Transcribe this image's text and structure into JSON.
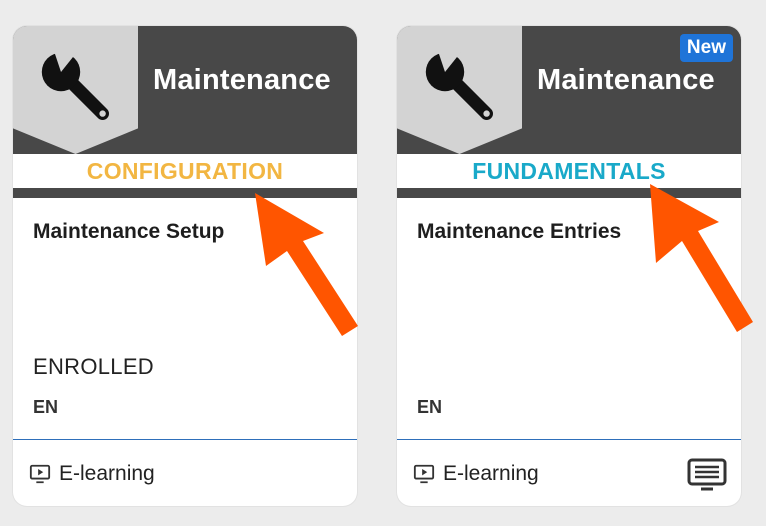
{
  "cards": [
    {
      "category": "Maintenance",
      "label": "CONFIGURATION",
      "label_color": "#f2b642",
      "badge": "",
      "title": "Maintenance Setup",
      "status": "ENROLLED",
      "language": "EN",
      "type": "E-learning",
      "icon": "wrench-icon"
    },
    {
      "category": "Maintenance",
      "label": "FUNDAMENTALS",
      "label_color": "#19a9c9",
      "badge": "New",
      "title": "Maintenance Entries",
      "status": "",
      "language": "EN",
      "type": "E-learning",
      "icon": "wrench-icon"
    }
  ],
  "colors": {
    "banner": "#484848",
    "tile": "#d3d3d3",
    "badge": "#1f74d8",
    "arrow": "#ff5500",
    "divider": "#2e6fba"
  }
}
